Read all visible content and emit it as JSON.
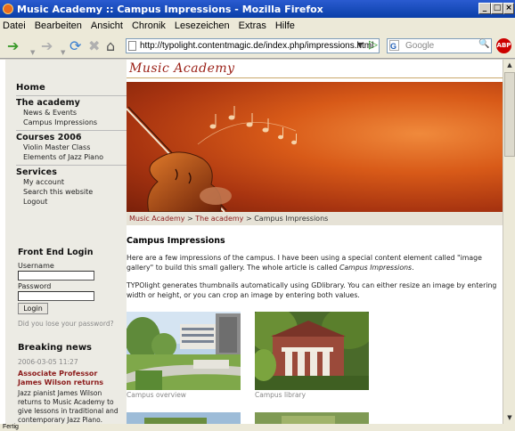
{
  "window": {
    "title": "Music Academy :: Campus Impressions - Mozilla Firefox",
    "min_label": "_",
    "max_label": "□",
    "close_label": "×"
  },
  "menu": [
    "Datei",
    "Bearbeiten",
    "Ansicht",
    "Chronik",
    "Lesezeichen",
    "Extras",
    "Hilfe"
  ],
  "toolbar": {
    "url": "http://typolight.contentmagic.de/index.php/impressions.html",
    "search_placeholder": "Google",
    "search_engine_letter": "G",
    "adblock_label": "ABP"
  },
  "site": {
    "logo": "Music Academy"
  },
  "sidebar": {
    "home": "Home",
    "sections": [
      {
        "title": "The academy",
        "items": [
          "News & Events",
          "Campus Impressions"
        ]
      },
      {
        "title": "Courses 2006",
        "items": [
          "Violin Master Class",
          "Elements of Jazz Piano"
        ]
      },
      {
        "title": "Services",
        "items": [
          "My account",
          "Search this website",
          "Logout"
        ]
      }
    ]
  },
  "login": {
    "title": "Front End Login",
    "username_label": "Username",
    "password_label": "Password",
    "button": "Login",
    "lost_password": "Did you lose your password?"
  },
  "news": {
    "title": "Breaking news",
    "date": "2006-03-05 11:27",
    "headline": "Associate Professor James Wilson returns",
    "text": "Jazz pianist James Wilson returns to Music Academy to give lessons in traditional and contemporary Jazz Piano."
  },
  "breadcrumb": {
    "item1": "Music Academy",
    "sep": " > ",
    "item2": "The academy",
    "current": "Campus Impressions"
  },
  "article": {
    "title": "Campus Impressions",
    "p1_start": "Here are a few impressions of the campus. I have been using a special content element called \"image gallery\" to build this small gallery. The whole article is called ",
    "p1_em": "Campus Impressions",
    "p1_end": ".",
    "p2": "TYPOlight generates thumbnails automatically using GDlibrary. You can either resize an image by entering width or height, or you can crop an image by entering both values."
  },
  "gallery": [
    {
      "caption": "Campus overview"
    },
    {
      "caption": "Campus library"
    }
  ],
  "status": "Fertig"
}
